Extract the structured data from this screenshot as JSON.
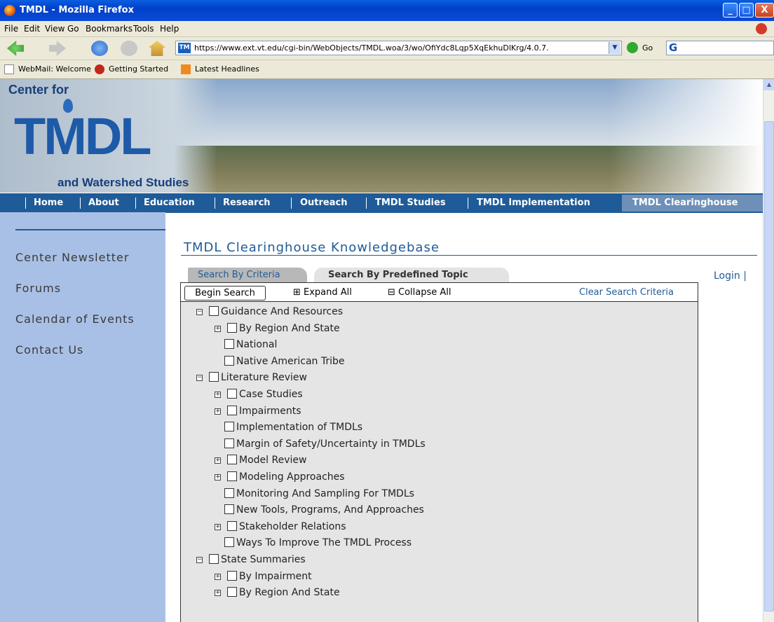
{
  "window": {
    "title": "TMDL - Mozilla Firefox",
    "min": "_",
    "max": "□",
    "close": "X"
  },
  "menu": [
    "File",
    "Edit",
    "View",
    "Go",
    "Bookmarks",
    "Tools",
    "Help"
  ],
  "url": "https://www.ext.vt.edu/cgi-bin/WebObjects/TMDL.woa/3/wo/OfiYdc8Lqp5XqEkhuDlKrg/4.0.7.",
  "go_label": "Go",
  "search_glyph": "G",
  "bookmarks": [
    "WebMail: Welcome",
    "Getting Started",
    "Latest Headlines"
  ],
  "logo": {
    "line1": "Center for",
    "big": "TMDL",
    "line2": "and Watershed Studies"
  },
  "nav": [
    "Home",
    "About",
    "Education",
    "Research",
    "Outreach",
    "TMDL Studies",
    "TMDL Implementation",
    "TMDL Clearinghouse"
  ],
  "sidebar": [
    "Center Newsletter",
    "Forums",
    "Calendar of Events",
    "Contact Us"
  ],
  "main": {
    "title": "TMDL Clearinghouse Knowledgebase",
    "login": "Login |",
    "tabs": [
      "Search By Criteria",
      "Search By Predefined Topic"
    ],
    "begin_search": "Begin Search",
    "expand_all": "⊞ Expand All",
    "collapse_all": "⊟ Collapse All",
    "clear": "Clear Search Criteria"
  },
  "tree": [
    {
      "label": "Guidance And Resources",
      "level": 0,
      "toggle": "−"
    },
    {
      "label": "By Region And State",
      "level": 1,
      "toggle": "+"
    },
    {
      "label": "National",
      "level": 1,
      "toggle": ""
    },
    {
      "label": "Native American Tribe",
      "level": 1,
      "toggle": ""
    },
    {
      "label": "Literature Review",
      "level": 0,
      "toggle": "−"
    },
    {
      "label": "Case Studies",
      "level": 1,
      "toggle": "+"
    },
    {
      "label": "Impairments",
      "level": 1,
      "toggle": "+"
    },
    {
      "label": "Implementation of TMDLs",
      "level": 1,
      "toggle": ""
    },
    {
      "label": "Margin of Safety/Uncertainty in TMDLs",
      "level": 1,
      "toggle": ""
    },
    {
      "label": "Model Review",
      "level": 1,
      "toggle": "+"
    },
    {
      "label": "Modeling Approaches",
      "level": 1,
      "toggle": "+"
    },
    {
      "label": "Monitoring And Sampling For TMDLs",
      "level": 1,
      "toggle": ""
    },
    {
      "label": "New Tools, Programs, And Approaches",
      "level": 1,
      "toggle": ""
    },
    {
      "label": "Stakeholder Relations",
      "level": 1,
      "toggle": "+"
    },
    {
      "label": "Ways To Improve The TMDL Process",
      "level": 1,
      "toggle": ""
    },
    {
      "label": "State Summaries",
      "level": 0,
      "toggle": "−"
    },
    {
      "label": "By Impairment",
      "level": 1,
      "toggle": "+"
    },
    {
      "label": "By Region And State",
      "level": 1,
      "toggle": "+"
    }
  ],
  "colors": {
    "nav_bg": "#1e5b98",
    "sidebar_bg": "#a9c0e6",
    "tree_bg": "#e5e5e5",
    "link": "#1e5b98"
  }
}
